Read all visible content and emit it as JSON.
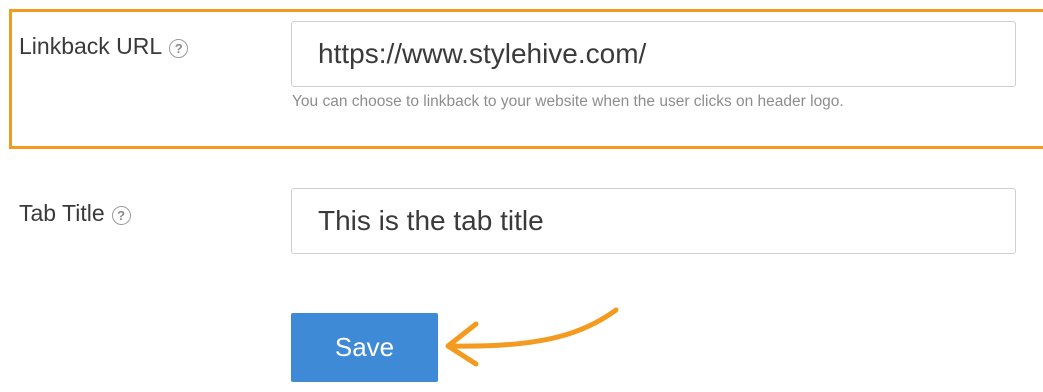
{
  "linkback": {
    "label": "Linkback URL",
    "help_glyph": "?",
    "value": "https://www.stylehive.com/",
    "help_text": "You can choose to linkback to your website when the user clicks on header logo."
  },
  "tab_title": {
    "label": "Tab Title",
    "help_glyph": "?",
    "value": "This is the tab title"
  },
  "save": {
    "label": "Save"
  },
  "colors": {
    "highlight": "#f39a1f",
    "button": "#3f8ad6",
    "arrow": "#f39a1f"
  },
  "icons": {
    "help": "help-circle-icon",
    "pointer": "arrow-icon"
  }
}
